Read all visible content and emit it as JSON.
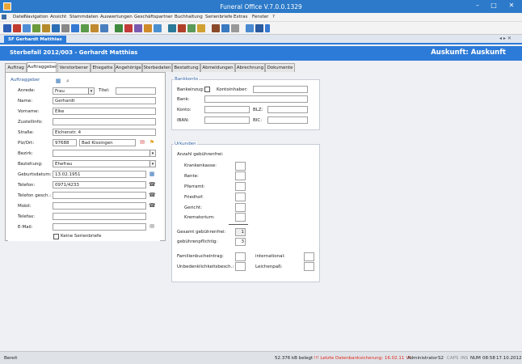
{
  "window": {
    "title": "Funeral Office V.7.0.0.1329",
    "minimize": "–",
    "maximize": "□",
    "close": "✕"
  },
  "menu": [
    "Datei",
    "Navigation",
    "Ansicht",
    "Stammdaten",
    "Auswertungen",
    "Geschäftspartner",
    "Buchhaltung",
    "Serienbriefe",
    "Extras",
    "Fenster",
    "?"
  ],
  "doctab": {
    "label": "SF Gerhardt Matthias",
    "nav": "◂ ▸ ✕"
  },
  "header": {
    "left": "Sterbefall 2012/003 - Gerhardt Matthias",
    "right": "Auskunft: Auskunft"
  },
  "tabs": [
    "Auftrag",
    "Auftraggeber",
    "Verstorbener",
    "Ehegatte",
    "Angehörige",
    "Sterbedaten",
    "Bestattung",
    "Abmeldungen",
    "Abrechnung",
    "Dokumente"
  ],
  "auftraggeber": {
    "group_title": "Auftraggeber",
    "anrede_label": "Anrede:",
    "anrede_value": "Frau",
    "titel_label": "Titel:",
    "titel_value": "",
    "name_label": "Name:",
    "name_value": "Gerhardt",
    "vorname_label": "Vorname:",
    "vorname_value": "Elke",
    "zustellinfo_label": "Zustellinfo:",
    "zustellinfo_value": "",
    "strasse_label": "Straße:",
    "strasse_value": "Eichenstr. 4",
    "plz_label": "Plz/Ort:",
    "plz_value": "97688",
    "ort_value": "Bad Kissingen",
    "bezirk_label": "Bezirk:",
    "bezirk_value": "",
    "beziehung_label": "Beziehung:",
    "beziehung_value": "Ehefrau",
    "geburtsdatum_label": "Geburtsdatum:",
    "geburtsdatum_value": "13.02.1951",
    "telefon_label": "Telefon:",
    "telefon_value": "0971/4233",
    "telefon_gesch_label": "Telefon gesch.:",
    "telefon_gesch_value": "",
    "mobil_label": "Mobil:",
    "mobil_value": "",
    "telefax_label": "Telefax:",
    "telefax_value": "",
    "email_label": "E-Mail:",
    "email_value": "",
    "keine_serienbriefe_label": "Keine Serienbriefe"
  },
  "bankkonto": {
    "group_title": "Bankkonto",
    "bankeinzug_label": "Bankeinzug:",
    "kontoinhaber_label": "Kontoinhaber:",
    "kontoinhaber_value": "",
    "bank_label": "Bank:",
    "bank_value": "",
    "konto_label": "Konto:",
    "konto_value": "",
    "blz_label": "BLZ:",
    "blz_value": "",
    "iban_label": "IBAN:",
    "iban_value": "",
    "bic_label": "BIC:",
    "bic_value": ""
  },
  "urkunden": {
    "group_title": "Urkunden",
    "anzahl_label": "Anzahl gebührenfrei:",
    "krankenkasse_label": "Krankenkasse:",
    "rente_label": "Rente:",
    "pfarramt_label": "Pfarramt:",
    "friedhof_label": "Friedhof:",
    "gericht_label": "Gericht:",
    "krematorium_label": "Krematorium:",
    "gesamt_label": "Gesamt gebührenfrei:",
    "gesamt_value": "1",
    "pflichtig_label": "gebührenpflichtig:",
    "pflichtig_value": "3",
    "familienbuch_label": "Familienbucheintrag:",
    "international_label": "international:",
    "unbedenklichkeit_label": "Unbedenklichkeitsbesch.:",
    "leichenpass_label": "Leichenpaß:"
  },
  "status": {
    "left": "Bereit",
    "belegt": "52.376 kB belegt",
    "backup": "!!! Letzte Datenbanksicherung: 16.02.11 !!!",
    "user": "Administrator",
    "s2": "S2",
    "caps": "CAPS",
    "ins": "INS",
    "num": "NUM",
    "time": "08:58",
    "date": "17.10.2012"
  },
  "colors": {
    "accent": "#2d7bd8",
    "titlebar": "#2c7ac9",
    "group_label": "#2a5d9f",
    "backup_warning": "#e0281c"
  }
}
